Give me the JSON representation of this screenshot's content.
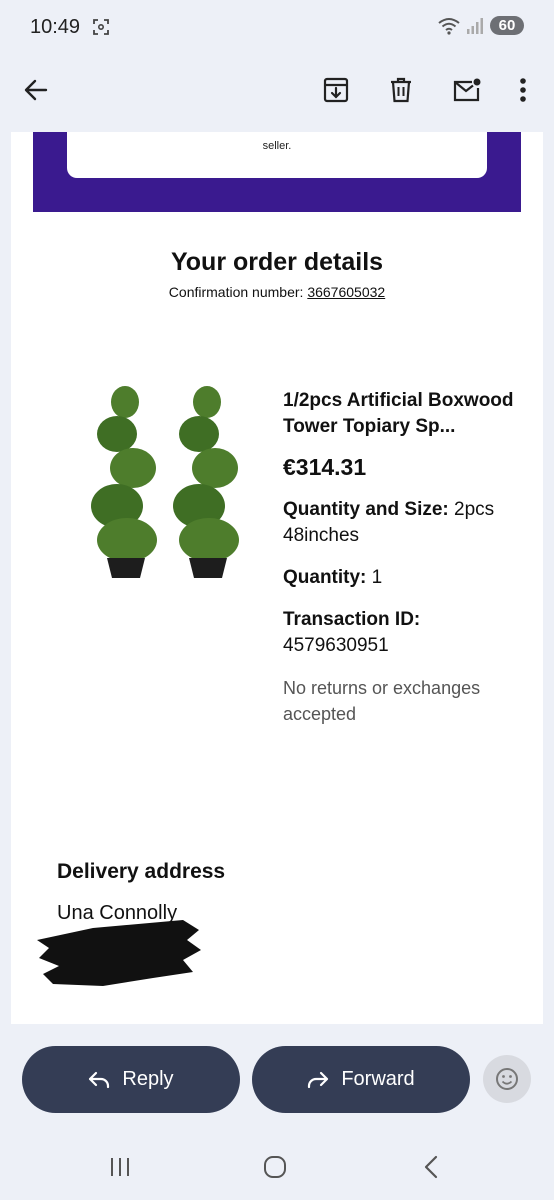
{
  "status_bar": {
    "time": "10:49",
    "battery": "60"
  },
  "email": {
    "banner_text": "seller.",
    "order_title": "Your order details",
    "confirmation_label": "Confirmation number:",
    "confirmation_number": "3667605032",
    "product": {
      "name": "1/2pcs Artificial Boxwood Tower Topiary Sp...",
      "price": "€314.31",
      "quantity_size_label": "Quantity and Size:",
      "quantity_size_value": "2pcs 48inches",
      "quantity_label": "Quantity:",
      "quantity_value": "1",
      "transaction_label": "Transaction ID:",
      "transaction_value": "4579630951",
      "policy": "No returns or exchanges accepted"
    },
    "delivery_title": "Delivery address",
    "delivery_name": "Una Connolly"
  },
  "actions": {
    "reply": "Reply",
    "forward": "Forward"
  },
  "icons": {
    "back": "back-arrow-icon",
    "archive": "archive-icon",
    "delete": "trash-icon",
    "unread": "mail-unread-icon",
    "more": "more-vert-icon",
    "reply": "reply-icon",
    "forward": "forward-icon",
    "emoji": "emoji-icon"
  },
  "colors": {
    "banner": "#3a1a8f",
    "buttons": "#343d55",
    "background": "#edf0f7"
  }
}
